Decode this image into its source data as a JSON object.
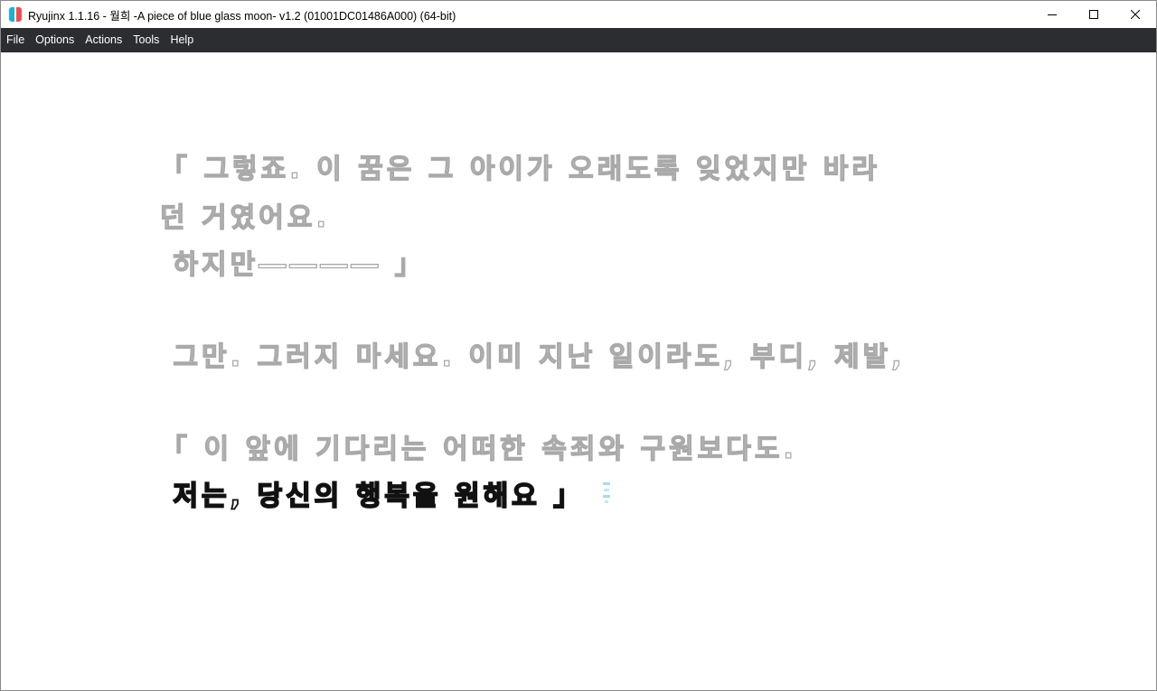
{
  "window": {
    "title": "Ryujinx 1.1.16 - 월희 -A piece of blue glass moon- v1.2 (01001DC01486A000) (64-bit)",
    "controls": [
      "minimize",
      "maximize",
      "close"
    ]
  },
  "menu": {
    "items": [
      "File",
      "Options",
      "Actions",
      "Tools",
      "Help"
    ]
  },
  "game": {
    "lines": [
      "「 그렇죠. 이 꿈은 그 아이가 오래도록 잊었지만 바라",
      "던 거였어요.",
      " 하지만―――― 」",
      " 그만. 그러지 마세요. 이미 지난 일이라도, 부디, 제발,",
      "「 이 앞에 기다리는 어떠한 속죄와 구원보다도.",
      " 저는, 당신의 행복을 원해요 」"
    ],
    "colors": {
      "faded_outline": "#a9a9a9",
      "active_outline": "#111111",
      "cursor": "#a8dde8"
    },
    "icons": [
      "advance-cursor-icon"
    ]
  },
  "colors": {
    "menubar_bg": "#2b2d31",
    "menubar_text": "#ffffff",
    "app_icon_left": "#1ab3d6",
    "app_icon_right": "#f04e4e"
  }
}
